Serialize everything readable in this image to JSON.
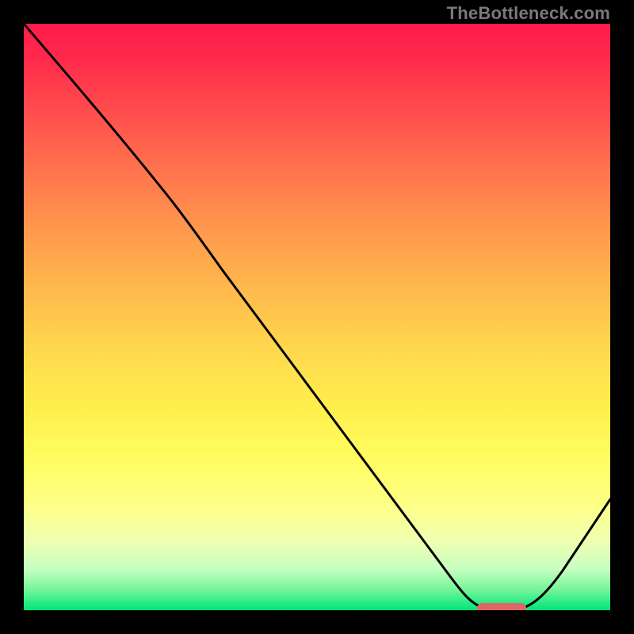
{
  "watermark": "TheBottleneck.com",
  "chart_data": {
    "type": "line",
    "title": "",
    "xlabel": "",
    "ylabel": "",
    "xlim": [
      0,
      100
    ],
    "ylim": [
      0,
      100
    ],
    "grid": false,
    "legend": false,
    "series": [
      {
        "name": "bottleneck-curve",
        "x": [
          0,
          6,
          12,
          19,
          26,
          32,
          38,
          45,
          52,
          58,
          64,
          70,
          73,
          76,
          80,
          84,
          88,
          92,
          96,
          100
        ],
        "y": [
          100,
          93,
          86,
          78,
          70,
          63,
          55,
          46,
          37,
          29,
          21,
          12,
          6,
          2,
          0,
          0,
          3,
          9,
          16,
          24
        ]
      }
    ],
    "annotations": [
      {
        "type": "marker",
        "name": "optimal-marker",
        "shape": "rounded-rect",
        "x_range": [
          76,
          85
        ],
        "y": 0,
        "color": "#e06666"
      }
    ],
    "background_gradient": {
      "stops": [
        {
          "pos": 0.0,
          "color": "#ff1a4b"
        },
        {
          "pos": 0.5,
          "color": "#ffc94d"
        },
        {
          "pos": 0.8,
          "color": "#fcff70"
        },
        {
          "pos": 1.0,
          "color": "#00e47a"
        }
      ]
    }
  }
}
